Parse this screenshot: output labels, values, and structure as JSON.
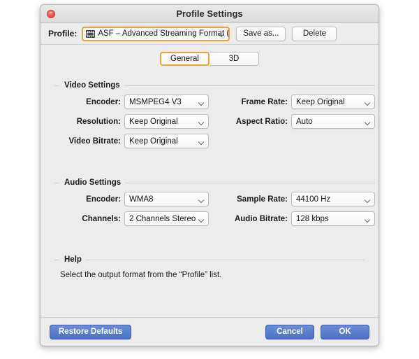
{
  "window": {
    "title": "Profile Settings",
    "close_icon": "close-icon"
  },
  "profile_bar": {
    "label": "Profile:",
    "icon": "film-strip-icon",
    "selected": "ASF – Advanced Streaming Format (*.asf)",
    "dropdown_icon": "chevron-down-icon",
    "save_as_label": "Save as...",
    "delete_label": "Delete"
  },
  "tabs": [
    {
      "label": "General",
      "selected": true
    },
    {
      "label": "3D",
      "selected": false
    }
  ],
  "video_settings": {
    "title": "Video Settings",
    "fields": [
      {
        "label": "Encoder:",
        "value": "MSMPEG4 V3"
      },
      {
        "label": "Frame Rate:",
        "value": "Keep Original"
      },
      {
        "label": "Resolution:",
        "value": "Keep Original"
      },
      {
        "label": "Aspect Ratio:",
        "value": "Auto"
      },
      {
        "label": "Video Bitrate:",
        "value": "Keep Original"
      }
    ]
  },
  "audio_settings": {
    "title": "Audio Settings",
    "fields": [
      {
        "label": "Encoder:",
        "value": "WMA8"
      },
      {
        "label": "Sample Rate:",
        "value": "44100 Hz"
      },
      {
        "label": "Channels:",
        "value": "2 Channels Stereo"
      },
      {
        "label": "Audio Bitrate:",
        "value": "128 kbps"
      }
    ]
  },
  "help": {
    "title": "Help",
    "text": "Select the output format from the “Profile” list."
  },
  "footer": {
    "restore_label": "Restore Defaults",
    "cancel_label": "Cancel",
    "ok_label": "OK"
  },
  "colors": {
    "accent_focus": "#e8a33d",
    "button_blue": "#4a72c4",
    "window_bg": "#ececec",
    "close_red": "#f35b50"
  }
}
